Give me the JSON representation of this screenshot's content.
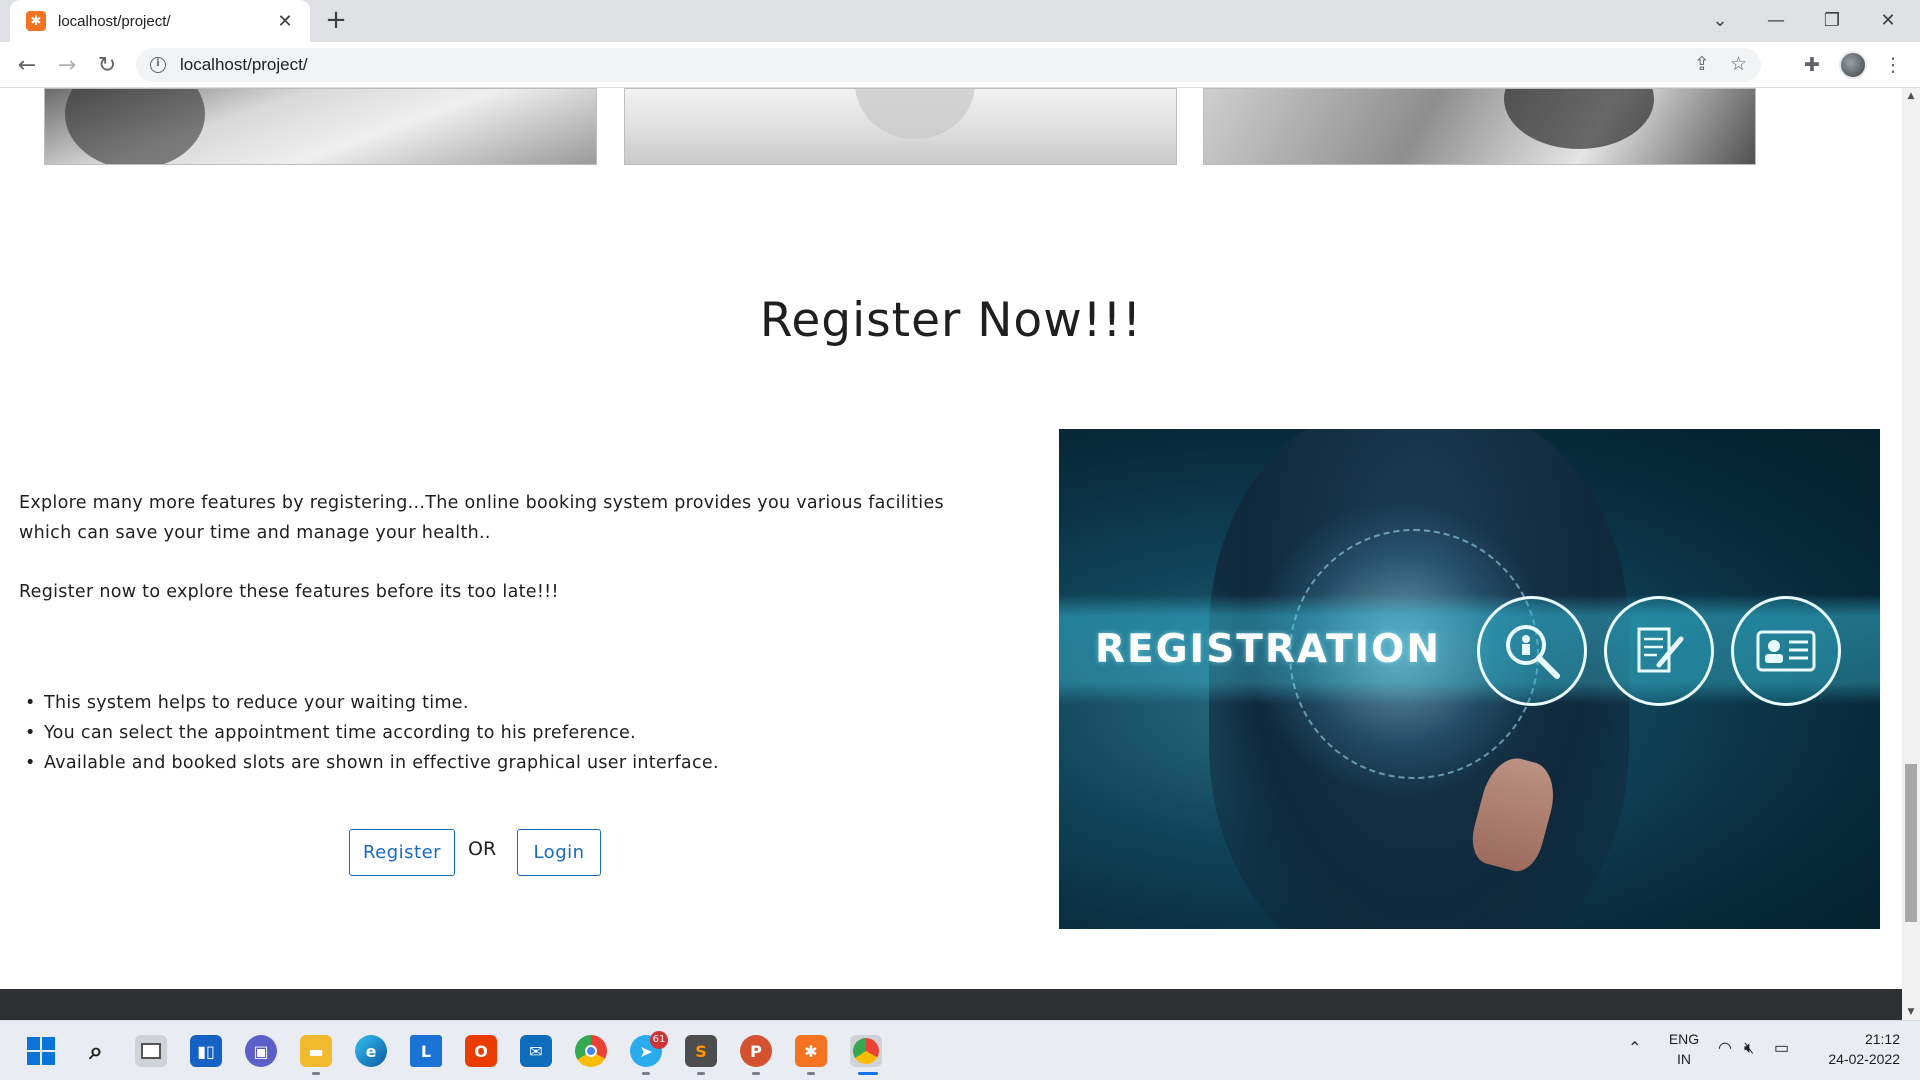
{
  "browser": {
    "tab_title": "localhost/project/",
    "tab_close": "✕",
    "new_tab": "+",
    "url": "localhost/project/"
  },
  "page": {
    "heading": "Register Now!!!",
    "intro": "Explore many more features by registering...The online booking system provides you various facilities which can save your time and manage your health..",
    "cta_text": "Register now to explore these features before its too late!!!",
    "features": [
      "This system helps to reduce your waiting time.",
      "You can select the appointment time according to his preference.",
      "Available and booked slots are shown in effective graphical user interface."
    ],
    "register_label": "Register",
    "or_label": "OR",
    "login_label": "Login",
    "image_word": "REGISTRATION"
  },
  "taskbar": {
    "telegram_badge": "61",
    "lang_top": "ENG",
    "lang_bottom": "IN",
    "time": "21:12",
    "date": "24-02-2022"
  },
  "colors": {
    "button_accent": "#1769c2",
    "footer": "#2d2f33",
    "tab_favicon": "#f37321"
  }
}
